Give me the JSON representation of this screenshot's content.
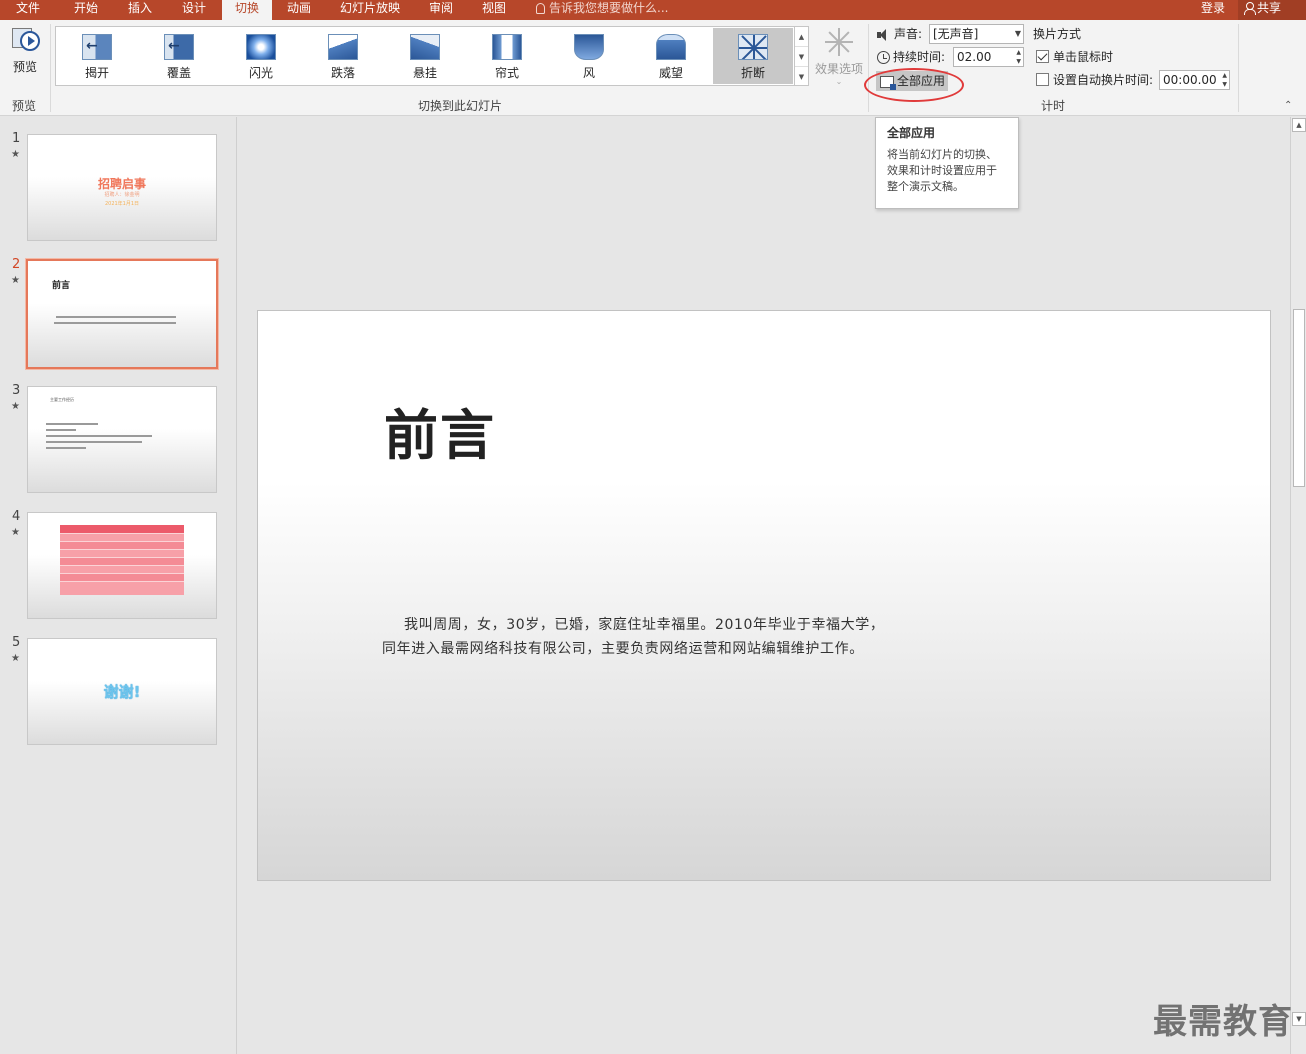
{
  "tabs": [
    {
      "label": "文件",
      "active": false
    },
    {
      "label": "开始",
      "active": false
    },
    {
      "label": "插入",
      "active": false
    },
    {
      "label": "设计",
      "active": false
    },
    {
      "label": "切换",
      "active": true
    },
    {
      "label": "动画",
      "active": false
    },
    {
      "label": "幻灯片放映",
      "active": false
    },
    {
      "label": "审阅",
      "active": false
    },
    {
      "label": "视图",
      "active": false
    }
  ],
  "tell_me": "告诉我您想要做什么...",
  "login": "登录",
  "share": "共享",
  "ribbon": {
    "preview_button": "预览",
    "preview_group": "预览",
    "transitions": [
      {
        "label": "揭开",
        "icon": "uncover-icon"
      },
      {
        "label": "覆盖",
        "icon": "cover-icon"
      },
      {
        "label": "闪光",
        "icon": "flash-icon"
      },
      {
        "label": "跌落",
        "icon": "fall-over-icon"
      },
      {
        "label": "悬挂",
        "icon": "drape-icon"
      },
      {
        "label": "帘式",
        "icon": "curtains-icon"
      },
      {
        "label": "风",
        "icon": "wind-icon"
      },
      {
        "label": "威望",
        "icon": "prestige-icon"
      },
      {
        "label": "折断",
        "icon": "shatter-icon",
        "selected": true
      }
    ],
    "transitions_group": "切换到此幻灯片",
    "effect_options": "效果选项",
    "sound_label": "声音:",
    "sound_value": "[无声音]",
    "duration_label": "持续时间:",
    "duration_value": "02.00",
    "apply_all": "全部应用",
    "advance_title": "换片方式",
    "on_click": "单击鼠标时",
    "on_click_checked": true,
    "after_label": "设置自动换片时间:",
    "after_checked": false,
    "after_value": "00:00.00",
    "timing_group": "计时"
  },
  "tooltip": {
    "title": "全部应用",
    "body": "将当前幻灯片的切换、效果和计时设置应用于整个演示文稿。"
  },
  "thumbnails": [
    {
      "number": "1",
      "title": "招聘启事",
      "subtitle": "招聘人：徐金明",
      "date": "2021年1月1日"
    },
    {
      "number": "2",
      "title": "前言",
      "selected": true
    },
    {
      "number": "3",
      "heading": "主要工作经历"
    },
    {
      "number": "4"
    },
    {
      "number": "5",
      "title": "谢谢!"
    }
  ],
  "slide": {
    "title": "前言",
    "body_line1": "我叫周周，女，30岁，已婚，家庭住址幸福里。2010年毕业于幸福大学，",
    "body_line2": "同年进入最需网络科技有限公司，主要负责网络运营和网站编辑维护工作。"
  },
  "watermark": "最需教育",
  "colors": {
    "accent": "#b7472a",
    "selection": "#e5785a",
    "annotation_circle": "#e03a3a"
  }
}
